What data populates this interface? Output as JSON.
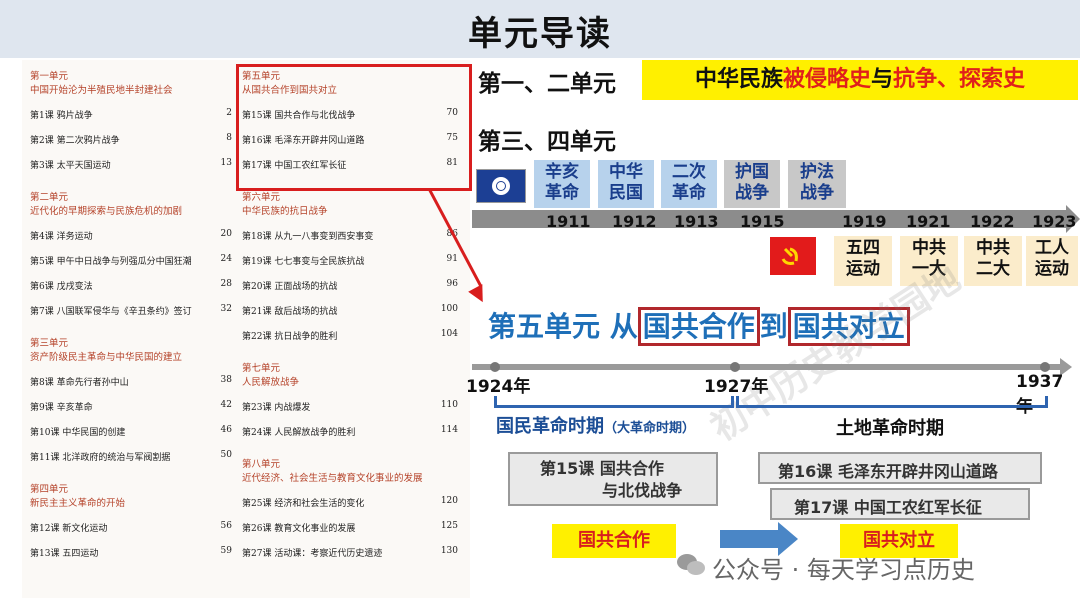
{
  "header": {
    "title": "单元导读"
  },
  "toc": {
    "left": [
      {
        "type": "unit",
        "title": "第一单元",
        "subtitle": "中国开始沦为半殖民地半封建社会"
      },
      {
        "type": "lesson",
        "label": "第1课  鸦片战争",
        "page": "2"
      },
      {
        "type": "lesson",
        "label": "第2课  第二次鸦片战争",
        "page": "8"
      },
      {
        "type": "lesson",
        "label": "第3课  太平天国运动",
        "page": "13"
      },
      {
        "type": "unit",
        "title": "第二单元",
        "subtitle": "近代化的早期探索与民族危机的加剧"
      },
      {
        "type": "lesson",
        "label": "第4课  洋务运动",
        "page": "20"
      },
      {
        "type": "lesson",
        "label": "第5课  甲午中日战争与列强瓜分中国狂潮",
        "page": "24"
      },
      {
        "type": "lesson",
        "label": "第6课  戊戌变法",
        "page": "28"
      },
      {
        "type": "lesson",
        "label": "第7课  八国联军侵华与《辛丑条约》签订",
        "page": "32"
      },
      {
        "type": "unit",
        "title": "第三单元",
        "subtitle": "资产阶级民主革命与中华民国的建立"
      },
      {
        "type": "lesson",
        "label": "第8课  革命先行者孙中山",
        "page": "38"
      },
      {
        "type": "lesson",
        "label": "第9课  辛亥革命",
        "page": "42"
      },
      {
        "type": "lesson",
        "label": "第10课  中华民国的创建",
        "page": "46"
      },
      {
        "type": "lesson",
        "label": "第11课  北洋政府的统治与军阀割据",
        "page": "50"
      },
      {
        "type": "unit",
        "title": "第四单元",
        "subtitle": "新民主主义革命的开始"
      },
      {
        "type": "lesson",
        "label": "第12课  新文化运动",
        "page": "56"
      },
      {
        "type": "lesson",
        "label": "第13课  五四运动",
        "page": "59"
      }
    ],
    "right": [
      {
        "type": "unit",
        "title": "第五单元",
        "subtitle": "从国共合作到国共对立"
      },
      {
        "type": "lesson",
        "label": "第15课  国共合作与北伐战争",
        "page": "70"
      },
      {
        "type": "lesson",
        "label": "第16课  毛泽东开辟井冈山道路",
        "page": "75"
      },
      {
        "type": "lesson",
        "label": "第17课  中国工农红军长征",
        "page": "81"
      },
      {
        "type": "unit",
        "title": "第六单元",
        "subtitle": "中华民族的抗日战争"
      },
      {
        "type": "lesson",
        "label": "第18课  从九一八事变到西安事变",
        "page": "86"
      },
      {
        "type": "lesson",
        "label": "第19课  七七事变与全民族抗战",
        "page": "91"
      },
      {
        "type": "lesson",
        "label": "第20课  正面战场的抗战",
        "page": "96"
      },
      {
        "type": "lesson",
        "label": "第21课  敌后战场的抗战",
        "page": "100"
      },
      {
        "type": "lesson",
        "label": "第22课  抗日战争的胜利",
        "page": "104"
      },
      {
        "type": "unit",
        "title": "第七单元",
        "subtitle": "人民解放战争"
      },
      {
        "type": "lesson",
        "label": "第23课  内战爆发",
        "page": "110"
      },
      {
        "type": "lesson",
        "label": "第24课  人民解放战争的胜利",
        "page": "114"
      },
      {
        "type": "unit",
        "title": "第八单元",
        "subtitle": "近代经济、社会生活与教育文化事业的发展"
      },
      {
        "type": "lesson",
        "label": "第25课  经济和社会生活的变化",
        "page": "120"
      },
      {
        "type": "lesson",
        "label": "第26课  教育文化事业的发展",
        "page": "125"
      },
      {
        "type": "lesson",
        "label": "第27课  活动课：考察近代历史遗迹",
        "page": "130"
      }
    ]
  },
  "row1": {
    "label": "第一、二单元",
    "banner_a": "中华民族",
    "banner_b": "被侵略史",
    "banner_c": "与",
    "banner_d": "抗争、探索史"
  },
  "row2": {
    "label": "第三、四单元"
  },
  "timeline1": {
    "years": [
      "1911",
      "1912",
      "1913",
      "1915",
      "1919",
      "1921",
      "1922",
      "1923"
    ],
    "top_events": [
      {
        "l1": "辛亥",
        "l2": "革命"
      },
      {
        "l1": "中华",
        "l2": "民国"
      },
      {
        "l1": "二次",
        "l2": "革命"
      },
      {
        "l1": "护国",
        "l2": "战争"
      },
      {
        "l1": "护法",
        "l2": "战争"
      }
    ],
    "bottom_events": [
      {
        "l1": "五四",
        "l2": "运动"
      },
      {
        "l1": "中共",
        "l2": "一大"
      },
      {
        "l1": "中共",
        "l2": "二大"
      },
      {
        "l1": "工人",
        "l2": "运动"
      }
    ]
  },
  "unit5": {
    "prefix": "第五单元 从",
    "a": "国共合作",
    "mid": "到",
    "b": "国共对立"
  },
  "timeline2": {
    "years": [
      "1924年",
      "1927年",
      "1937年"
    ],
    "period1": "国民革命时期",
    "period1_note": "（大革命时期）",
    "period2": "土地革命时期"
  },
  "lessons": {
    "l15_a": "第15课  国共合作",
    "l15_b": "与北伐战争",
    "l16": "第16课  毛泽东开辟井冈山道路",
    "l17": "第17课  中国工农红军长征"
  },
  "summary": {
    "left": "国共合作",
    "right": "国共对立"
  },
  "watermark": "初中历史教学园地",
  "footer": "公众号 · 每天学习点历史",
  "colors": {
    "accent_red": "#d81e1e",
    "banner_yellow": "#fff000",
    "unit_blue": "#1e6fb8"
  }
}
